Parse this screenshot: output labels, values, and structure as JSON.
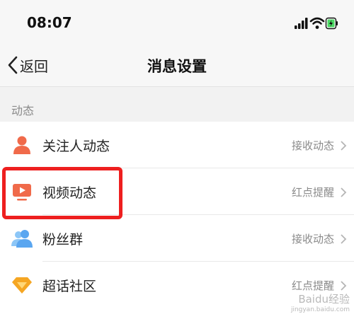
{
  "status_bar": {
    "time": "08:07",
    "icons": [
      "cellular-signal-icon",
      "wifi-icon",
      "battery-charging-icon"
    ],
    "battery_color": "#4cd964"
  },
  "nav": {
    "back_label": "返回",
    "title": "消息设置"
  },
  "section": {
    "label": "动态"
  },
  "rows": [
    {
      "label": "关注人动态",
      "value": "接收动态",
      "icon": "person-icon",
      "icon_color": "#f06a4a"
    },
    {
      "label": "视频动态",
      "value": "红点提醒",
      "icon": "video-play-icon",
      "icon_color": "#f06a4a"
    },
    {
      "label": "粉丝群",
      "value": "接收动态",
      "icon": "group-icon",
      "icon_color": "#5aa6f0"
    },
    {
      "label": "超话社区",
      "value": "红点提醒",
      "icon": "diamond-icon",
      "icon_color": "#f5a623"
    }
  ],
  "annotation": {
    "highlight_color": "#ee1f1f"
  },
  "watermark": {
    "text": "Baidu经验",
    "sub": "jingyan.baidu.com"
  }
}
